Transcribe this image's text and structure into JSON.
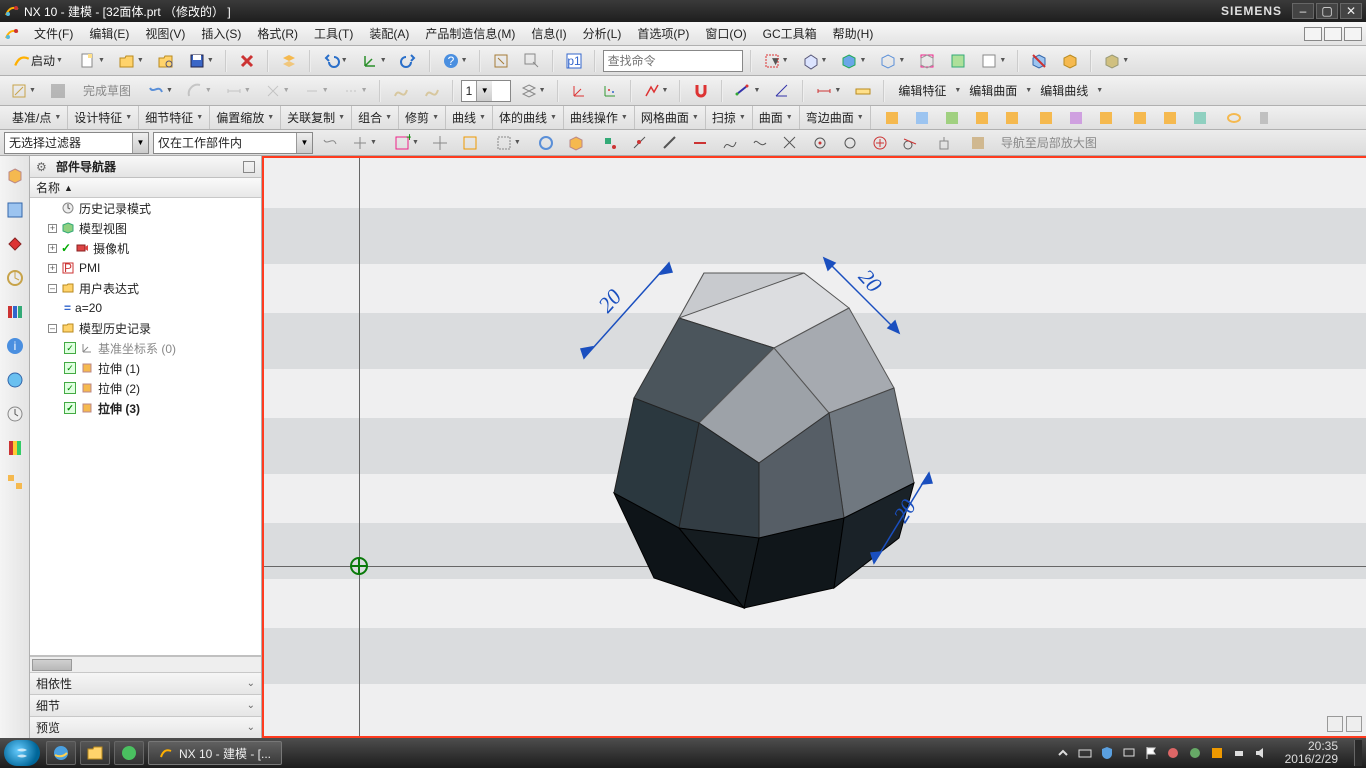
{
  "titlebar": {
    "text": "NX 10 - 建模 - [32面体.prt （修改的） ]",
    "brand": "SIEMENS"
  },
  "menu": {
    "items": [
      "文件(F)",
      "编辑(E)",
      "视图(V)",
      "插入(S)",
      "格式(R)",
      "工具(T)",
      "装配(A)",
      "产品制造信息(M)",
      "信息(I)",
      "分析(L)",
      "首选项(P)",
      "窗口(O)",
      "GC工具箱",
      "帮助(H)"
    ]
  },
  "toolbar1": {
    "start": "启动",
    "search_placeholder": "查找命令",
    "combo_val": "1"
  },
  "editlabels": {
    "a": "编辑特征",
    "b": "编辑曲面",
    "c": "编辑曲线"
  },
  "toolbar2": {
    "donesketch": "完成草图"
  },
  "textrow": {
    "groups": [
      "基准/点",
      "设计特征",
      "细节特征",
      "偏置缩放",
      "关联复制",
      "组合",
      "修剪",
      "曲线",
      "体的曲线",
      "曲线操作",
      "网格曲面",
      "扫掠",
      "曲面",
      "弯边曲面"
    ]
  },
  "filter": {
    "sel1": "无选择过滤器",
    "sel2": "仅在工作部件内",
    "hint": "导航至局部放大图"
  },
  "nav": {
    "title": "部件导航器",
    "col": "名称",
    "rows": {
      "history_mode": "历史记录模式",
      "model_view": "模型视图",
      "camera": "摄像机",
      "pmi": "PMI",
      "user_expr": "用户表达式",
      "a20": "a=20",
      "model_hist": "模型历史记录",
      "datum": "基准坐标系 (0)",
      "ext1": "拉伸 (1)",
      "ext2": "拉伸 (2)",
      "ext3": "拉伸 (3)"
    },
    "panels": {
      "depend": "相依性",
      "detail": "细节",
      "preview": "预览"
    }
  },
  "dims": {
    "d1": "20",
    "d2": "20",
    "d3": "20"
  },
  "taskbar": {
    "task": "NX 10 - 建模 - [...",
    "time": "20:35",
    "date": "2016/2/29"
  }
}
